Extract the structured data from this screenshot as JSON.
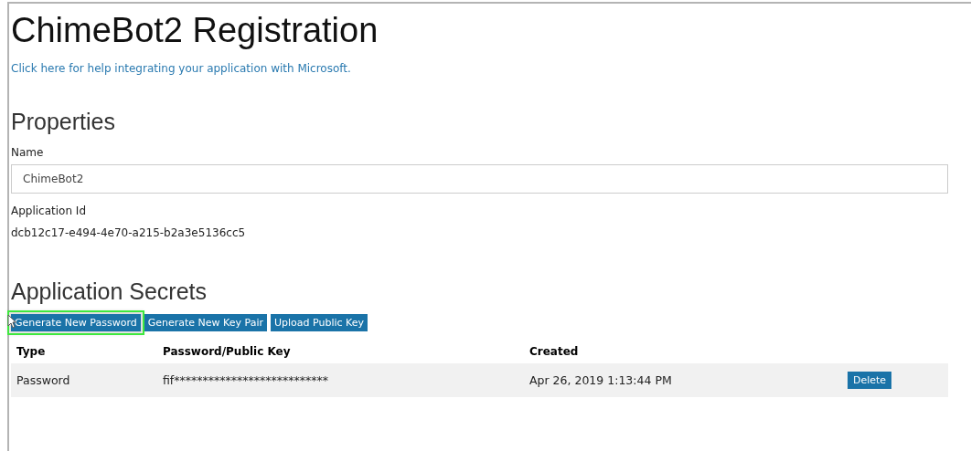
{
  "title": "ChimeBot2 Registration",
  "help_link": "Click here for help integrating your application with Microsoft.",
  "properties": {
    "heading": "Properties",
    "name_label": "Name",
    "name_value": "ChimeBot2",
    "app_id_label": "Application Id",
    "app_id_value": "dcb12c17-e494-4e70-a215-b2a3e5136cc5"
  },
  "secrets": {
    "heading": "Application Secrets",
    "buttons": [
      {
        "label": "Generate New Password",
        "highlighted": true
      },
      {
        "label": "Generate New Key Pair",
        "highlighted": false
      },
      {
        "label": "Upload Public Key",
        "highlighted": false
      }
    ],
    "columns": [
      "Type",
      "Password/Public Key",
      "Created"
    ],
    "rows": [
      {
        "type": "Password",
        "key": "fif***************************",
        "created": "Apr 26, 2019 1:13:44 PM",
        "action": "Delete"
      }
    ]
  }
}
